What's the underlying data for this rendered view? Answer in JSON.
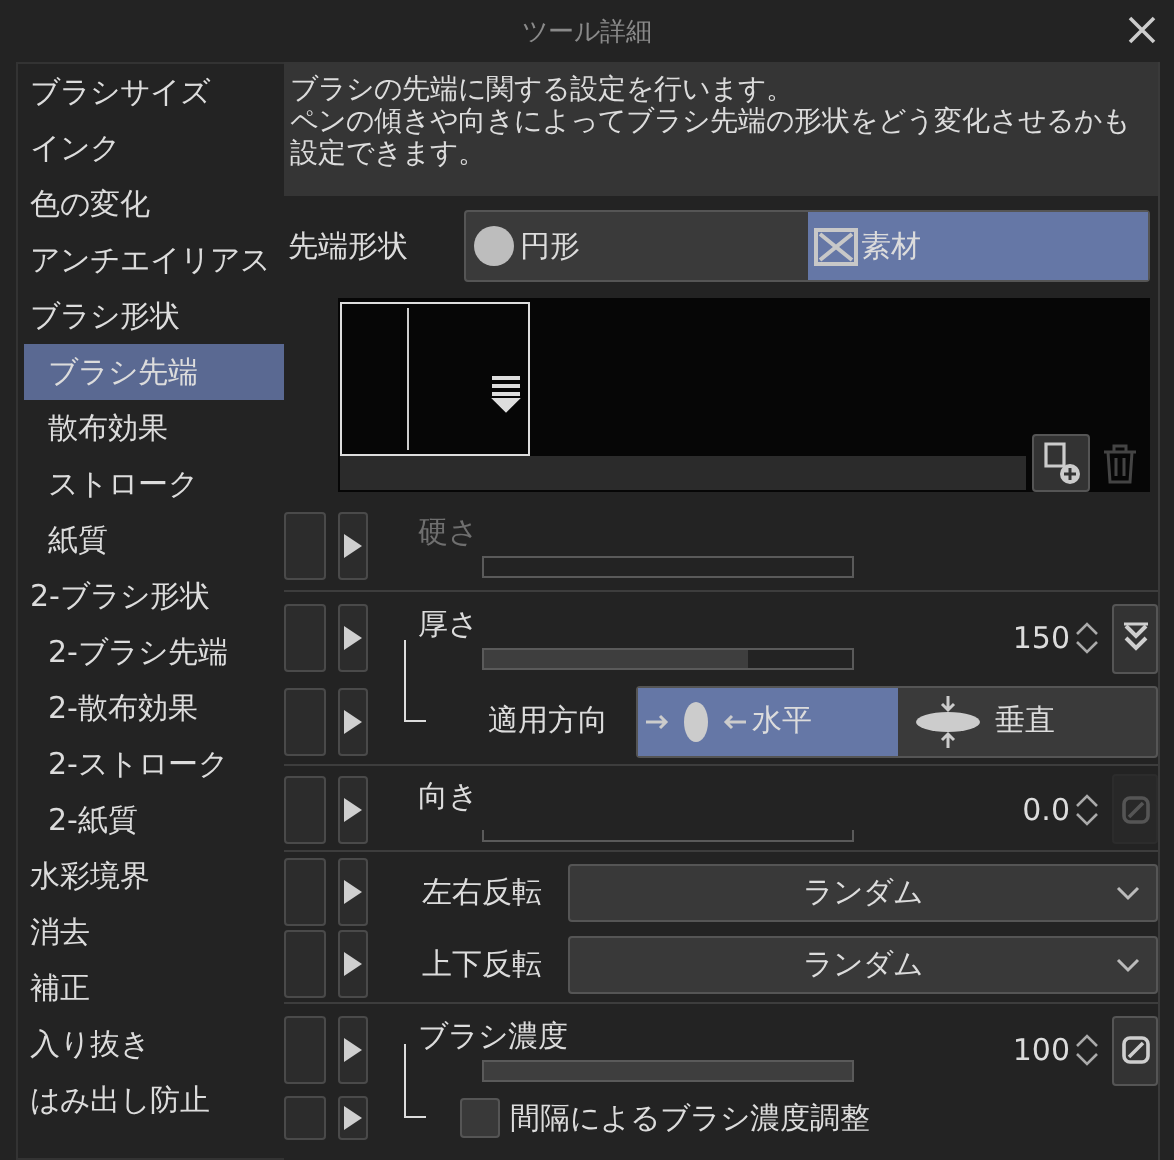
{
  "window": {
    "title": "ツール詳細"
  },
  "sidebar": {
    "items": [
      {
        "label": "ブラシサイズ",
        "selected": false
      },
      {
        "label": "インク",
        "selected": false
      },
      {
        "label": "色の変化",
        "selected": false
      },
      {
        "label": "アンチエイリアス",
        "selected": false
      },
      {
        "label": "ブラシ形状",
        "selected": false,
        "children": [
          {
            "label": "ブラシ先端",
            "selected": true
          },
          {
            "label": "散布効果",
            "selected": false
          },
          {
            "label": "ストローク",
            "selected": false
          },
          {
            "label": "紙質",
            "selected": false
          }
        ]
      },
      {
        "label": "2-ブラシ形状",
        "selected": false,
        "children": [
          {
            "label": "2-ブラシ先端",
            "selected": false
          },
          {
            "label": "2-散布効果",
            "selected": false
          },
          {
            "label": "2-ストローク",
            "selected": false
          },
          {
            "label": "2-紙質",
            "selected": false
          }
        ]
      },
      {
        "label": "水彩境界",
        "selected": false
      },
      {
        "label": "消去",
        "selected": false
      },
      {
        "label": "補正",
        "selected": false
      },
      {
        "label": "入り抜き",
        "selected": false
      },
      {
        "label": "はみ出し防止",
        "selected": false
      }
    ]
  },
  "description": [
    "ブラシの先端に関する設定を行います。",
    "ペンの傾きや向きによってブラシ先端の形状をどう変化させるかも設定できます。"
  ],
  "tip_shape": {
    "label": "先端形状",
    "options": [
      {
        "label": "円形",
        "kind": "circle",
        "selected": false
      },
      {
        "label": "素材",
        "kind": "material",
        "selected": true
      }
    ]
  },
  "groups": [
    [
      {
        "kind": "slider",
        "label": "硬さ",
        "disabled": true,
        "level": 0
      }
    ],
    [
      {
        "kind": "slider",
        "label": "厚さ",
        "disabled": false,
        "level": 0.72,
        "value": "150",
        "button": {
          "kind": "chevrons",
          "enabled": true
        }
      },
      {
        "kind": "direction",
        "label": "適用方向",
        "dependent": true,
        "options": [
          {
            "label": "水平",
            "kind": "horizontal",
            "selected": true
          },
          {
            "label": "垂直",
            "kind": "vertical",
            "selected": false
          }
        ]
      }
    ],
    [
      {
        "kind": "angle",
        "label": "向き",
        "disabled": false,
        "level": 0,
        "value": "0.0",
        "button": {
          "kind": "slash",
          "enabled": false
        }
      }
    ],
    [
      {
        "kind": "dropdown",
        "label": "左右反転",
        "value": "ランダム"
      },
      {
        "kind": "dropdown",
        "label": "上下反転",
        "value": "ランダム"
      }
    ],
    [
      {
        "kind": "slider",
        "label": "ブラシ濃度",
        "disabled": false,
        "level": 1,
        "value": "100",
        "button": {
          "kind": "slash",
          "enabled": true
        }
      },
      {
        "kind": "checkbox",
        "label": "間隔によるブラシ濃度調整",
        "dependent": true,
        "checked": false
      }
    ]
  ]
}
